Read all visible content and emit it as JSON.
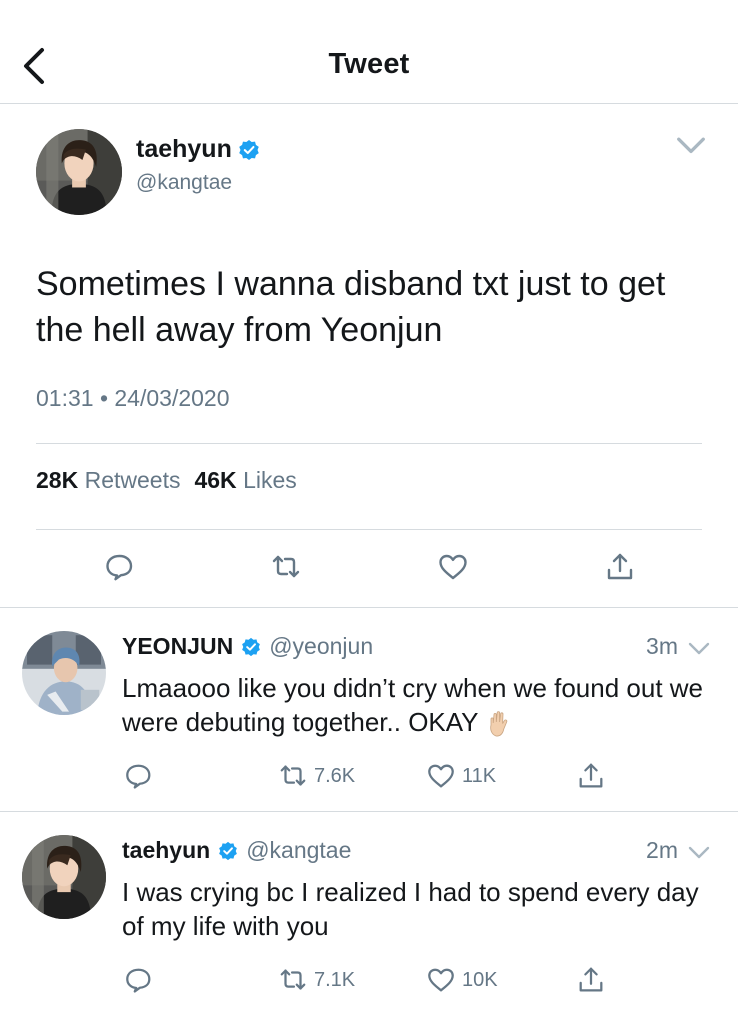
{
  "header": {
    "title": "Tweet"
  },
  "tweet": {
    "name": "taehyun",
    "handle": "@kangtae",
    "text": "Sometimes I wanna disband txt just to get the hell away from Yeonjun",
    "timestamp": "01:31 • 24/03/2020",
    "retweets_count": "28K",
    "retweets_label": "Retweets",
    "likes_count": "46K",
    "likes_label": "Likes"
  },
  "replies": [
    {
      "name": "YEONJUN",
      "handle": "@yeonjun",
      "time": "3m",
      "text": "Lmaaooo like you didn’t cry when we found out we were debuting together.. OKAY",
      "emoji": "raised-hand",
      "retweets": "7.6K",
      "likes": "11K"
    },
    {
      "name": "taehyun",
      "handle": "@kangtae",
      "time": "2m",
      "text": "I was crying bc I realized I had to spend every day of my life with you",
      "retweets": "7.1K",
      "likes": "10K"
    }
  ],
  "colors": {
    "accent": "#1da1f2",
    "muted": "#657786",
    "text": "#14171a",
    "divider": "#d6dbdf"
  },
  "icons": [
    "back-arrow-icon",
    "verified-badge-icon",
    "chevron-down-icon",
    "reply-icon",
    "retweet-icon",
    "like-icon",
    "share-icon"
  ]
}
